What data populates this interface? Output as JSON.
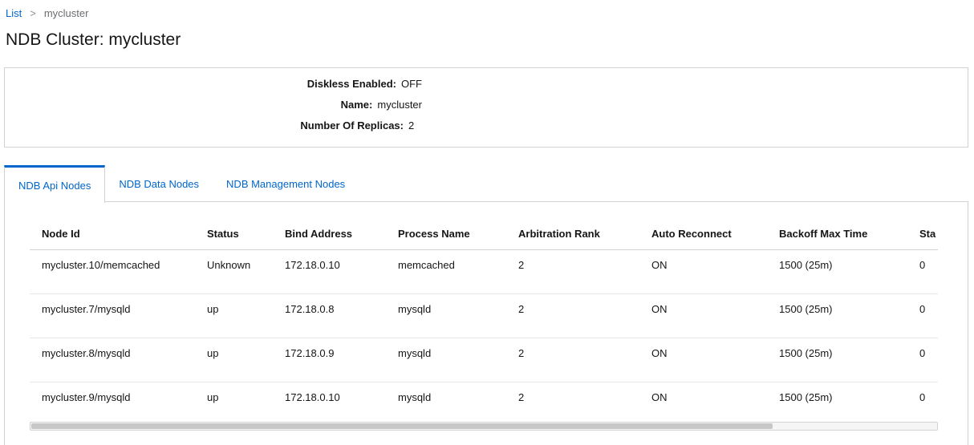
{
  "breadcrumb": {
    "link": "List",
    "separator": ">",
    "current": "mycluster"
  },
  "page_title": "NDB Cluster: mycluster",
  "details": [
    {
      "label": "Diskless Enabled:",
      "value": "OFF"
    },
    {
      "label": "Name:",
      "value": "mycluster"
    },
    {
      "label": "Number Of Replicas:",
      "value": "2"
    }
  ],
  "tabs": [
    {
      "label": "NDB Api Nodes",
      "active": true
    },
    {
      "label": "NDB Data Nodes",
      "active": false
    },
    {
      "label": "NDB Management Nodes",
      "active": false
    }
  ],
  "table": {
    "columns": [
      "Node Id",
      "Status",
      "Bind Address",
      "Process Name",
      "Arbitration Rank",
      "Auto Reconnect",
      "Backoff Max Time",
      "Sta"
    ],
    "rows": [
      [
        "mycluster.10/memcached",
        "Unknown",
        "172.18.0.10",
        "memcached",
        "2",
        "ON",
        "1500 (25m)",
        "0"
      ],
      [
        "mycluster.7/mysqld",
        "up",
        "172.18.0.8",
        "mysqld",
        "2",
        "ON",
        "1500 (25m)",
        "0"
      ],
      [
        "mycluster.8/mysqld",
        "up",
        "172.18.0.9",
        "mysqld",
        "2",
        "ON",
        "1500 (25m)",
        "0"
      ],
      [
        "mycluster.9/mysqld",
        "up",
        "172.18.0.10",
        "mysqld",
        "2",
        "ON",
        "1500 (25m)",
        "0"
      ]
    ]
  },
  "colors": {
    "link": "#0066cc",
    "border": "#d2d2d2",
    "text": "#151515"
  }
}
